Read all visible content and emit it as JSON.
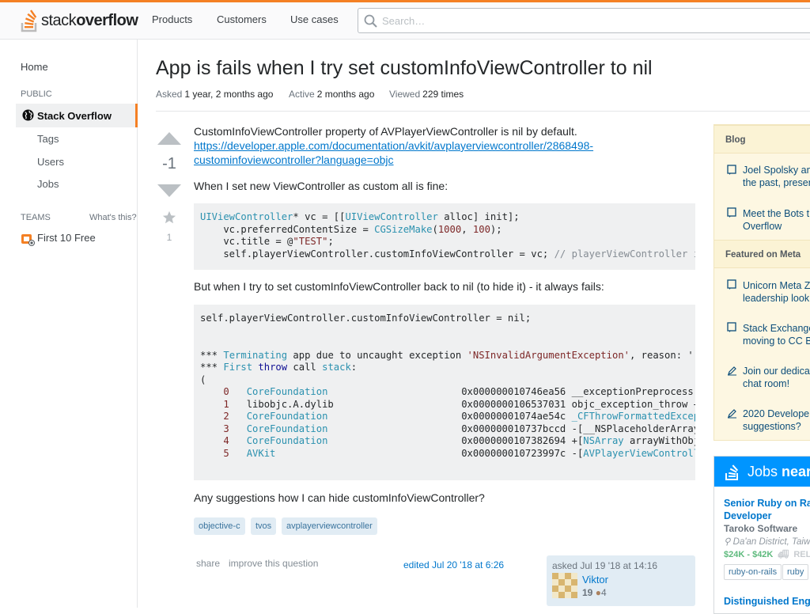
{
  "header": {
    "logo_text_light": "stack",
    "logo_text_bold": "overflow",
    "nav": [
      "Products",
      "Customers",
      "Use cases"
    ],
    "search_placeholder": "Search…"
  },
  "leftnav": {
    "home": "Home",
    "public_label": "PUBLIC",
    "stack_overflow": "Stack Overflow",
    "tags": "Tags",
    "users": "Users",
    "jobs": "Jobs",
    "teams_label": "TEAMS",
    "whats_this": "What's this?",
    "first_free": "First 10 Free"
  },
  "question": {
    "title": "App is fails when I try set customInfoViewController to nil",
    "asked_label": "Asked",
    "asked_value": "1 year, 2 months ago",
    "active_label": "Active",
    "active_value": "2 months ago",
    "viewed_label": "Viewed",
    "viewed_value": "229 times",
    "score": "-1",
    "favorite_count": "1",
    "p1": "CustomInfoViewController property of AVPlayerViewController is nil by default.",
    "link_line1": "https://developer.apple.com/documentation/avkit/avplayerviewcontroller/2868498-",
    "link_line2": "custominfoviewcontroller?language=objc",
    "p2": "When I set new ViewController as custom all is fine:",
    "p3": "But when I try to set customInfoViewController back to nil (to hide it) - it always fails:",
    "p4": "Any suggestions how I can hide customInfoViewController?",
    "code1": {
      "l1_type": "UIViewController",
      "l1_a": "* vc = [[",
      "l1_b": " alloc] init];",
      "l2_a": "    vc.preferredContentSize = ",
      "l2_fn": "CGSizeMake",
      "l2_n1": "1000",
      "l2_n2": "100",
      "l3_a": "    vc.title = @",
      "l3_str": "\"TEST\"",
      "l4_a": "    self.playerViewController.customInfoViewController = vc; ",
      "l4_cm": "// playerViewController is"
    },
    "code2": {
      "l1": "self.playerViewController.customInfoViewController = nil;",
      "t1_a": "*** ",
      "t1_kw": "Terminating",
      "t1_b": " app due to uncaught exception ",
      "t1_str": "'NSInvalidArgumentException'",
      "t1_c": ", reason: '",
      "t2_a": "*** ",
      "t2_kw1": "First",
      "t2_kw2": "throw",
      "t2_b": " call ",
      "t2_kw3": "stack",
      "t2_c": ":",
      "paren": "(",
      "frames": [
        {
          "n": "0",
          "lib": "CoreFoundation",
          "addr": "0x000000010746ea56",
          "sym_pre": " __exceptionPreprocess + ",
          "sym_hl": ""
        },
        {
          "n": "1",
          "lib": "libobjc.A.dylib",
          "addr": "0x0000000106537031",
          "sym_pre": " objc_exception_throw + ",
          "sym_hl": ""
        },
        {
          "n": "2",
          "lib": "CoreFoundation",
          "addr": "0x00000001074ae54c",
          "sym_pre": " ",
          "sym_hl": "_CFThrowFormattedExcept"
        },
        {
          "n": "3",
          "lib": "CoreFoundation",
          "addr": "0x000000010737bccd",
          "sym_pre": " -[__NSPlaceholderArray",
          "sym_hl": ""
        },
        {
          "n": "4",
          "lib": "CoreFoundation",
          "addr": "0x0000000107382694",
          "sym_pre": " +[",
          "sym_hl": "NSArray",
          "sym_post": " arrayWithObje"
        },
        {
          "n": "5",
          "lib": "AVKit",
          "addr": "0x000000010723997c",
          "sym_pre": " -[",
          "sym_hl": "AVPlayerViewControlle"
        }
      ]
    },
    "tags": [
      "objective-c",
      "tvos",
      "avplayerviewcontroller"
    ],
    "share": "share",
    "improve": "improve this question",
    "edited": "edited Jul 20 '18 at 6:26",
    "owner_asked": "asked Jul 19 '18 at 14:16",
    "owner_name": "Viktor",
    "owner_rep": "19",
    "owner_bronze": "4"
  },
  "sidebar": {
    "blog_head": "Blog",
    "blog_items": [
      [
        "Joel Spolsky an",
        "the past, presen"
      ],
      [
        "Meet the Bots th",
        "Overflow"
      ]
    ],
    "meta_head": "Featured on Meta",
    "meta_items": [
      [
        "Unicorn Meta Zo",
        "leadership look"
      ],
      [
        "Stack Exchange",
        "moving to CC B"
      ],
      [
        "Join our dedicat",
        "chat room!"
      ],
      [
        "2020 Developer",
        "suggestions?"
      ]
    ]
  },
  "jobs": {
    "head_light": "Jobs ",
    "head_bold": "near",
    "job1_title_l1": "Senior Ruby on Ra",
    "job1_title_l2": "Developer",
    "job1_company": "Taroko Software",
    "job1_location": "Da'an District, Taiwa",
    "job1_salary": "$24K - $42K",
    "job1_reloc": "RELO",
    "job1_tags": [
      "ruby-on-rails",
      "ruby"
    ],
    "job2_title": "Distinguished Engi"
  },
  "colors": {
    "accent": "#f48024",
    "link": "#0077cc",
    "tag_bg": "#e1ecf4",
    "tag_fg": "#39739d",
    "code_bg": "#eff0f1",
    "sidebar_bg": "#fdf7e2",
    "jobs_blue": "#0095ff"
  }
}
